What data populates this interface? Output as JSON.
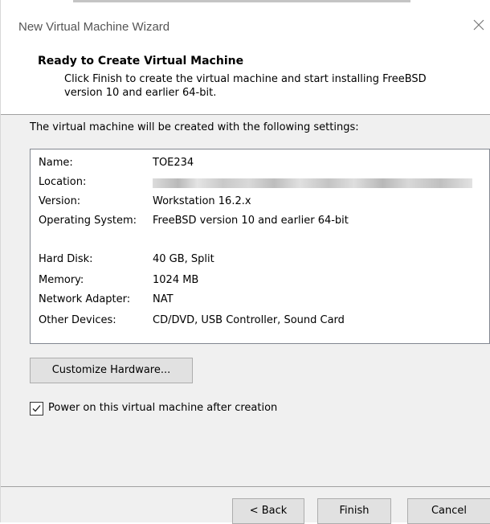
{
  "window": {
    "title": "New Virtual Machine Wizard",
    "close_icon": "close-icon"
  },
  "header": {
    "title": "Ready to Create Virtual Machine",
    "description": "Click Finish to create the virtual machine and start installing FreeBSD version 10 and earlier 64-bit."
  },
  "intro": "The virtual machine will be created with the following settings:",
  "settings": [
    {
      "label": "Name:",
      "value": "TOE234"
    },
    {
      "label": "Location:",
      "value": ""
    },
    {
      "label": "Version:",
      "value": "Workstation 16.2.x"
    },
    {
      "label": "Operating System:",
      "value": "FreeBSD version 10 and earlier 64-bit"
    },
    {
      "label": "Hard Disk:",
      "value": "40 GB, Split"
    },
    {
      "label": "Memory:",
      "value": "1024 MB"
    },
    {
      "label": "Network Adapter:",
      "value": "NAT"
    },
    {
      "label": "Other Devices:",
      "value": "CD/DVD, USB Controller, Sound Card"
    }
  ],
  "customize_button": "Customize Hardware...",
  "power_on": {
    "label": "Power on this virtual machine after creation",
    "checked": true
  },
  "buttons": {
    "back": "< Back",
    "finish": "Finish",
    "cancel": "Cancel"
  }
}
